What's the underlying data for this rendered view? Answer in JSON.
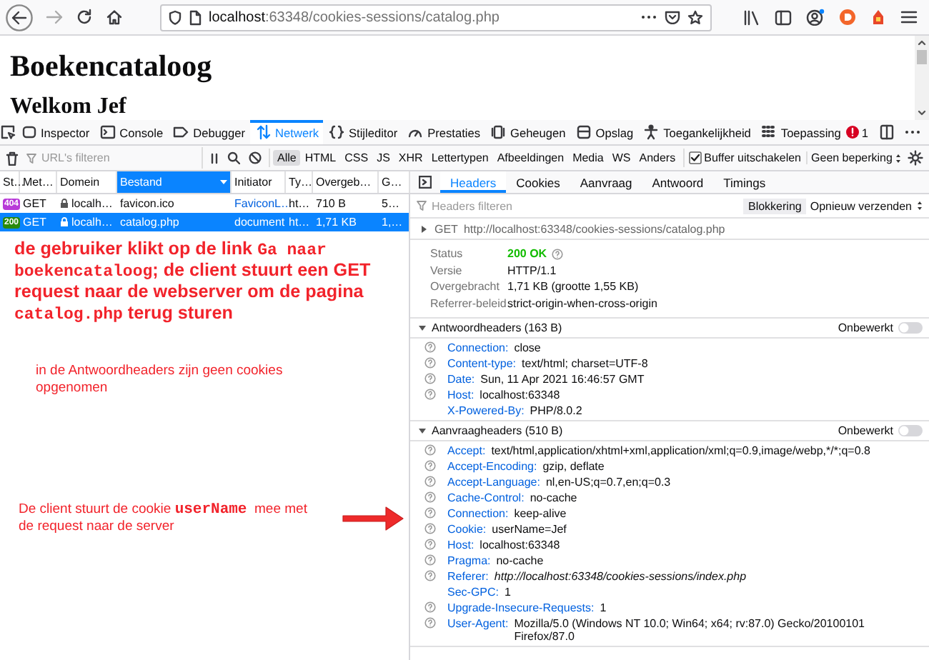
{
  "browser": {
    "url_host": "localhost",
    "url_rest": ":63348/cookies-sessions/catalog.php"
  },
  "page": {
    "heading": "Boekencataloog",
    "subheading": "Welkom Jef"
  },
  "devtools": {
    "tabs": [
      {
        "label": "Inspector",
        "selected": false
      },
      {
        "label": "Console",
        "selected": false
      },
      {
        "label": "Debugger",
        "selected": false
      },
      {
        "label": "Netwerk",
        "selected": true
      },
      {
        "label": "Stijleditor",
        "selected": false
      },
      {
        "label": "Prestaties",
        "selected": false
      },
      {
        "label": "Geheugen",
        "selected": false
      },
      {
        "label": "Opslag",
        "selected": false
      },
      {
        "label": "Toegankelijkheid",
        "selected": false
      },
      {
        "label": "Toepassing",
        "selected": false
      }
    ],
    "error_count": "1"
  },
  "network_toolbar": {
    "filter_placeholder": "URL's filteren",
    "type_filters": [
      {
        "label": "Alle",
        "selected": true
      },
      {
        "label": "HTML",
        "selected": false
      },
      {
        "label": "CSS",
        "selected": false
      },
      {
        "label": "JS",
        "selected": false
      },
      {
        "label": "XHR",
        "selected": false
      },
      {
        "label": "Lettertypen",
        "selected": false
      },
      {
        "label": "Afbeeldingen",
        "selected": false
      },
      {
        "label": "Media",
        "selected": false
      },
      {
        "label": "WS",
        "selected": false
      },
      {
        "label": "Anders",
        "selected": false
      }
    ],
    "disable_cache": {
      "label": "Buffer uitschakelen",
      "checked": true
    },
    "throttling": "Geen beperking"
  },
  "requests": {
    "columns": [
      {
        "label": "St…",
        "selected": false
      },
      {
        "label": "Met…",
        "selected": false
      },
      {
        "label": "Domein",
        "selected": false
      },
      {
        "label": "Bestand",
        "selected": true
      },
      {
        "label": "Initiator",
        "selected": false
      },
      {
        "label": "Ty…",
        "selected": false
      },
      {
        "label": "Overgeb…",
        "selected": false
      },
      {
        "label": "G…",
        "selected": false
      }
    ],
    "rows": [
      {
        "status": "404",
        "color": "#b83ad8",
        "method": "GET",
        "domain": "localh…",
        "file": "favicon.ico",
        "initiator": "FaviconL…",
        "initiator_link": true,
        "type": "ht…",
        "transferred": "710 B",
        "size": "5…",
        "selected": false
      },
      {
        "status": "200",
        "color": "#2a8a0a",
        "method": "GET",
        "domain": "localh…",
        "file": "catalog.php",
        "initiator": "document",
        "initiator_link": false,
        "type": "ht…",
        "transferred": "1,71 KB",
        "size": "1,…",
        "selected": true
      }
    ]
  },
  "annotations": [
    {
      "kind": "large",
      "segments": [
        {
          "text": "de gebruiker klikt op de link ",
          "code": false
        },
        {
          "text": "Ga naar boekencataloog",
          "code": true
        },
        {
          "text": "; de client stuurt een GET request naar de webserver om de pagina ",
          "code": false
        },
        {
          "text": "catalog.php",
          "code": true
        },
        {
          "text": " terug sturen",
          "code": false
        }
      ]
    },
    {
      "kind": "small",
      "segments": [
        {
          "text": "in de Antwoordheaders zijn geen cookies opgenomen",
          "code": false
        }
      ]
    },
    {
      "kind": "pointer",
      "segments": [
        {
          "text": "De client stuurt de cookie ",
          "code": false
        },
        {
          "text": "userName",
          "code": true
        },
        {
          "text": "  mee met de request naar de server",
          "code": false
        }
      ]
    }
  ],
  "details": {
    "tabs": [
      {
        "label": "Headers",
        "selected": true
      },
      {
        "label": "Cookies",
        "selected": false
      },
      {
        "label": "Aanvraag",
        "selected": false
      },
      {
        "label": "Antwoord",
        "selected": false
      },
      {
        "label": "Timings",
        "selected": false
      }
    ],
    "filter_placeholder": "Headers filteren",
    "blocking": "Blokkering",
    "resend": "Opnieuw verzenden",
    "request_method": "GET",
    "request_url": "http://localhost:63348/cookies-sessions/catalog.php",
    "request_expanded": false,
    "summary": [
      {
        "label": "Status",
        "value": "200 OK",
        "kind": "status"
      },
      {
        "label": "Versie",
        "value": "HTTP/1.1",
        "kind": "text"
      },
      {
        "label": "Overgebracht",
        "value": "1,71 KB (grootte 1,55 KB)",
        "kind": "text"
      },
      {
        "label": "Referrer-beleid",
        "value": "strict-origin-when-cross-origin",
        "kind": "text"
      }
    ],
    "sections": [
      {
        "title": "Antwoordheaders (163 B)",
        "expanded": true,
        "raw_label": "Onbewerkt",
        "raw": false,
        "headers": [
          {
            "name": "Connection:",
            "value": "close",
            "help": true,
            "kind": "text"
          },
          {
            "name": "Content-type:",
            "value": "text/html; charset=UTF-8",
            "help": true,
            "kind": "text"
          },
          {
            "name": "Date:",
            "value": "Sun, 11 Apr 2021 16:46:57 GMT",
            "help": true,
            "kind": "text"
          },
          {
            "name": "Host:",
            "value": "localhost:63348",
            "help": true,
            "kind": "text"
          },
          {
            "name": "X-Powered-By:",
            "value": "PHP/8.0.2",
            "help": false,
            "kind": "text"
          }
        ]
      },
      {
        "title": "Aanvraagheaders (510 B)",
        "expanded": true,
        "raw_label": "Onbewerkt",
        "raw": false,
        "headers": [
          {
            "name": "Accept:",
            "value": "text/html,application/xhtml+xml,application/xml;q=0.9,image/webp,*/*;q=0.8",
            "help": true,
            "kind": "text"
          },
          {
            "name": "Accept-Encoding:",
            "value": "gzip, deflate",
            "help": true,
            "kind": "text"
          },
          {
            "name": "Accept-Language:",
            "value": "nl,en-US;q=0.7,en;q=0.3",
            "help": true,
            "kind": "text"
          },
          {
            "name": "Cache-Control:",
            "value": "no-cache",
            "help": true,
            "kind": "text"
          },
          {
            "name": "Connection:",
            "value": "keep-alive",
            "help": true,
            "kind": "text"
          },
          {
            "name": "Cookie:",
            "value": "userName=Jef",
            "help": true,
            "kind": "text"
          },
          {
            "name": "Host:",
            "value": "localhost:63348",
            "help": true,
            "kind": "text"
          },
          {
            "name": "Pragma:",
            "value": "no-cache",
            "help": true,
            "kind": "text"
          },
          {
            "name": "Referer:",
            "value": "http://localhost:63348/cookies-sessions/index.php",
            "help": true,
            "kind": "url"
          },
          {
            "name": "Sec-GPC:",
            "value": "1",
            "help": false,
            "kind": "text"
          },
          {
            "name": "Upgrade-Insecure-Requests:",
            "value": "1",
            "help": true,
            "kind": "text"
          },
          {
            "name": "User-Agent:",
            "value": "Mozilla/5.0 (Windows NT 10.0; Win64; x64; rv:87.0) Gecko/20100101 Firefox/87.0",
            "help": true,
            "kind": "text"
          }
        ]
      }
    ]
  }
}
